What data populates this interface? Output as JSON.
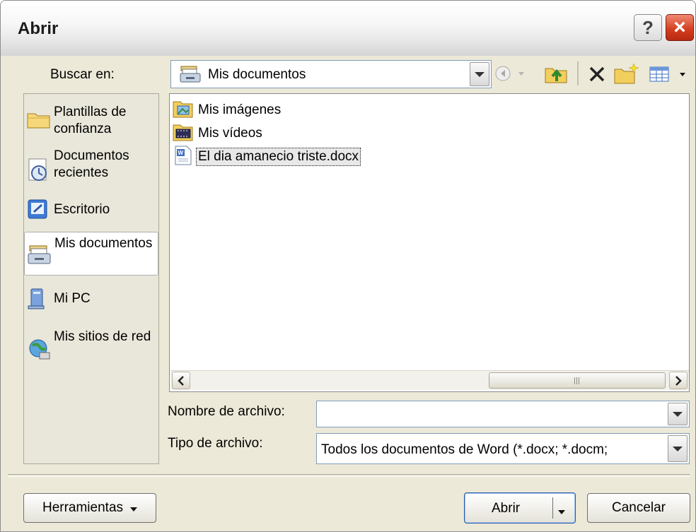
{
  "window": {
    "title": "Abrir",
    "help": "?",
    "close": "×"
  },
  "lookin": {
    "label": "Buscar en:",
    "value": "Mis documentos"
  },
  "toolbar": {
    "back_icon": "back-arrow-icon",
    "up_icon": "up-folder-icon",
    "delete_icon": "delete-x-icon",
    "new_folder_icon": "new-folder-icon",
    "views_icon": "views-icon"
  },
  "places": [
    {
      "label": "Plantillas de confianza",
      "icon": "folder-icon"
    },
    {
      "label": "Documentos recientes",
      "icon": "recent-documents-icon"
    },
    {
      "label": "Escritorio",
      "icon": "desktop-icon"
    },
    {
      "label": "Mis documentos",
      "icon": "my-documents-icon",
      "selected": true
    },
    {
      "label": "Mi PC",
      "icon": "my-computer-icon"
    },
    {
      "label": "Mis sitios de red",
      "icon": "network-places-icon"
    }
  ],
  "files": [
    {
      "name": "Mis imágenes",
      "icon": "pictures-folder-icon"
    },
    {
      "name": "Mis vídeos",
      "icon": "videos-folder-icon"
    },
    {
      "name": "El dia amanecio triste.docx",
      "icon": "word-document-icon",
      "selected": true
    }
  ],
  "scrollbar": {
    "thumb_grip": "|||"
  },
  "filename": {
    "label": "Nombre de archivo:",
    "value": ""
  },
  "filetype": {
    "label": "Tipo de archivo:",
    "value": "Todos los documentos de Word (*.docx; *.docm;"
  },
  "buttons": {
    "tools": "Herramientas",
    "open": "Abrir",
    "cancel": "Cancelar"
  }
}
